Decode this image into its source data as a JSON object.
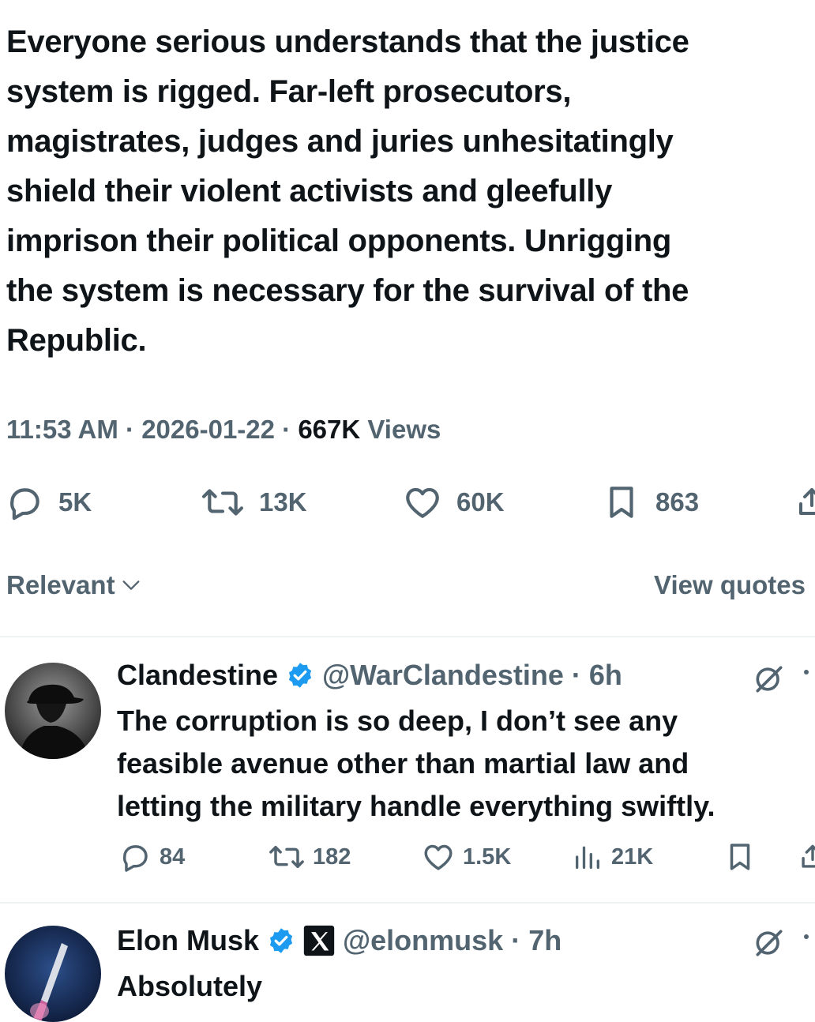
{
  "tweet": {
    "text": "Everyone serious understands that the justice\nsystem is rigged. Far-left prosecutors,\nmagistrates, judges and juries unhesitatingly\nshield their violent activists and gleefully\nimprison their political opponents. Unrigging\nthe system is necessary for the survival of the\nRepublic.",
    "time": "11:53 AM",
    "date": "2026-01-22",
    "views_count": "667K",
    "views_label": "Views",
    "replies": "5K",
    "reposts": "13K",
    "likes": "60K",
    "bookmarks": "863"
  },
  "sort": {
    "label": "Relevant",
    "view_quotes": "View quotes"
  },
  "replies": [
    {
      "name": "Clandestine",
      "handle": "@WarClandestine",
      "age": "6h",
      "text": "The corruption is so deep, I don’t see any\nfeasible avenue other than martial law and\nletting the military handle everything swiftly.",
      "replies": "84",
      "reposts": "182",
      "likes": "1.5K",
      "views": "21K"
    },
    {
      "name": "Elon Musk",
      "handle": "@elonmusk",
      "age": "7h",
      "text": "Absolutely"
    }
  ],
  "colors": {
    "verified": "#1d9bf0",
    "secondary": "#536471",
    "primary": "#0f1419"
  }
}
